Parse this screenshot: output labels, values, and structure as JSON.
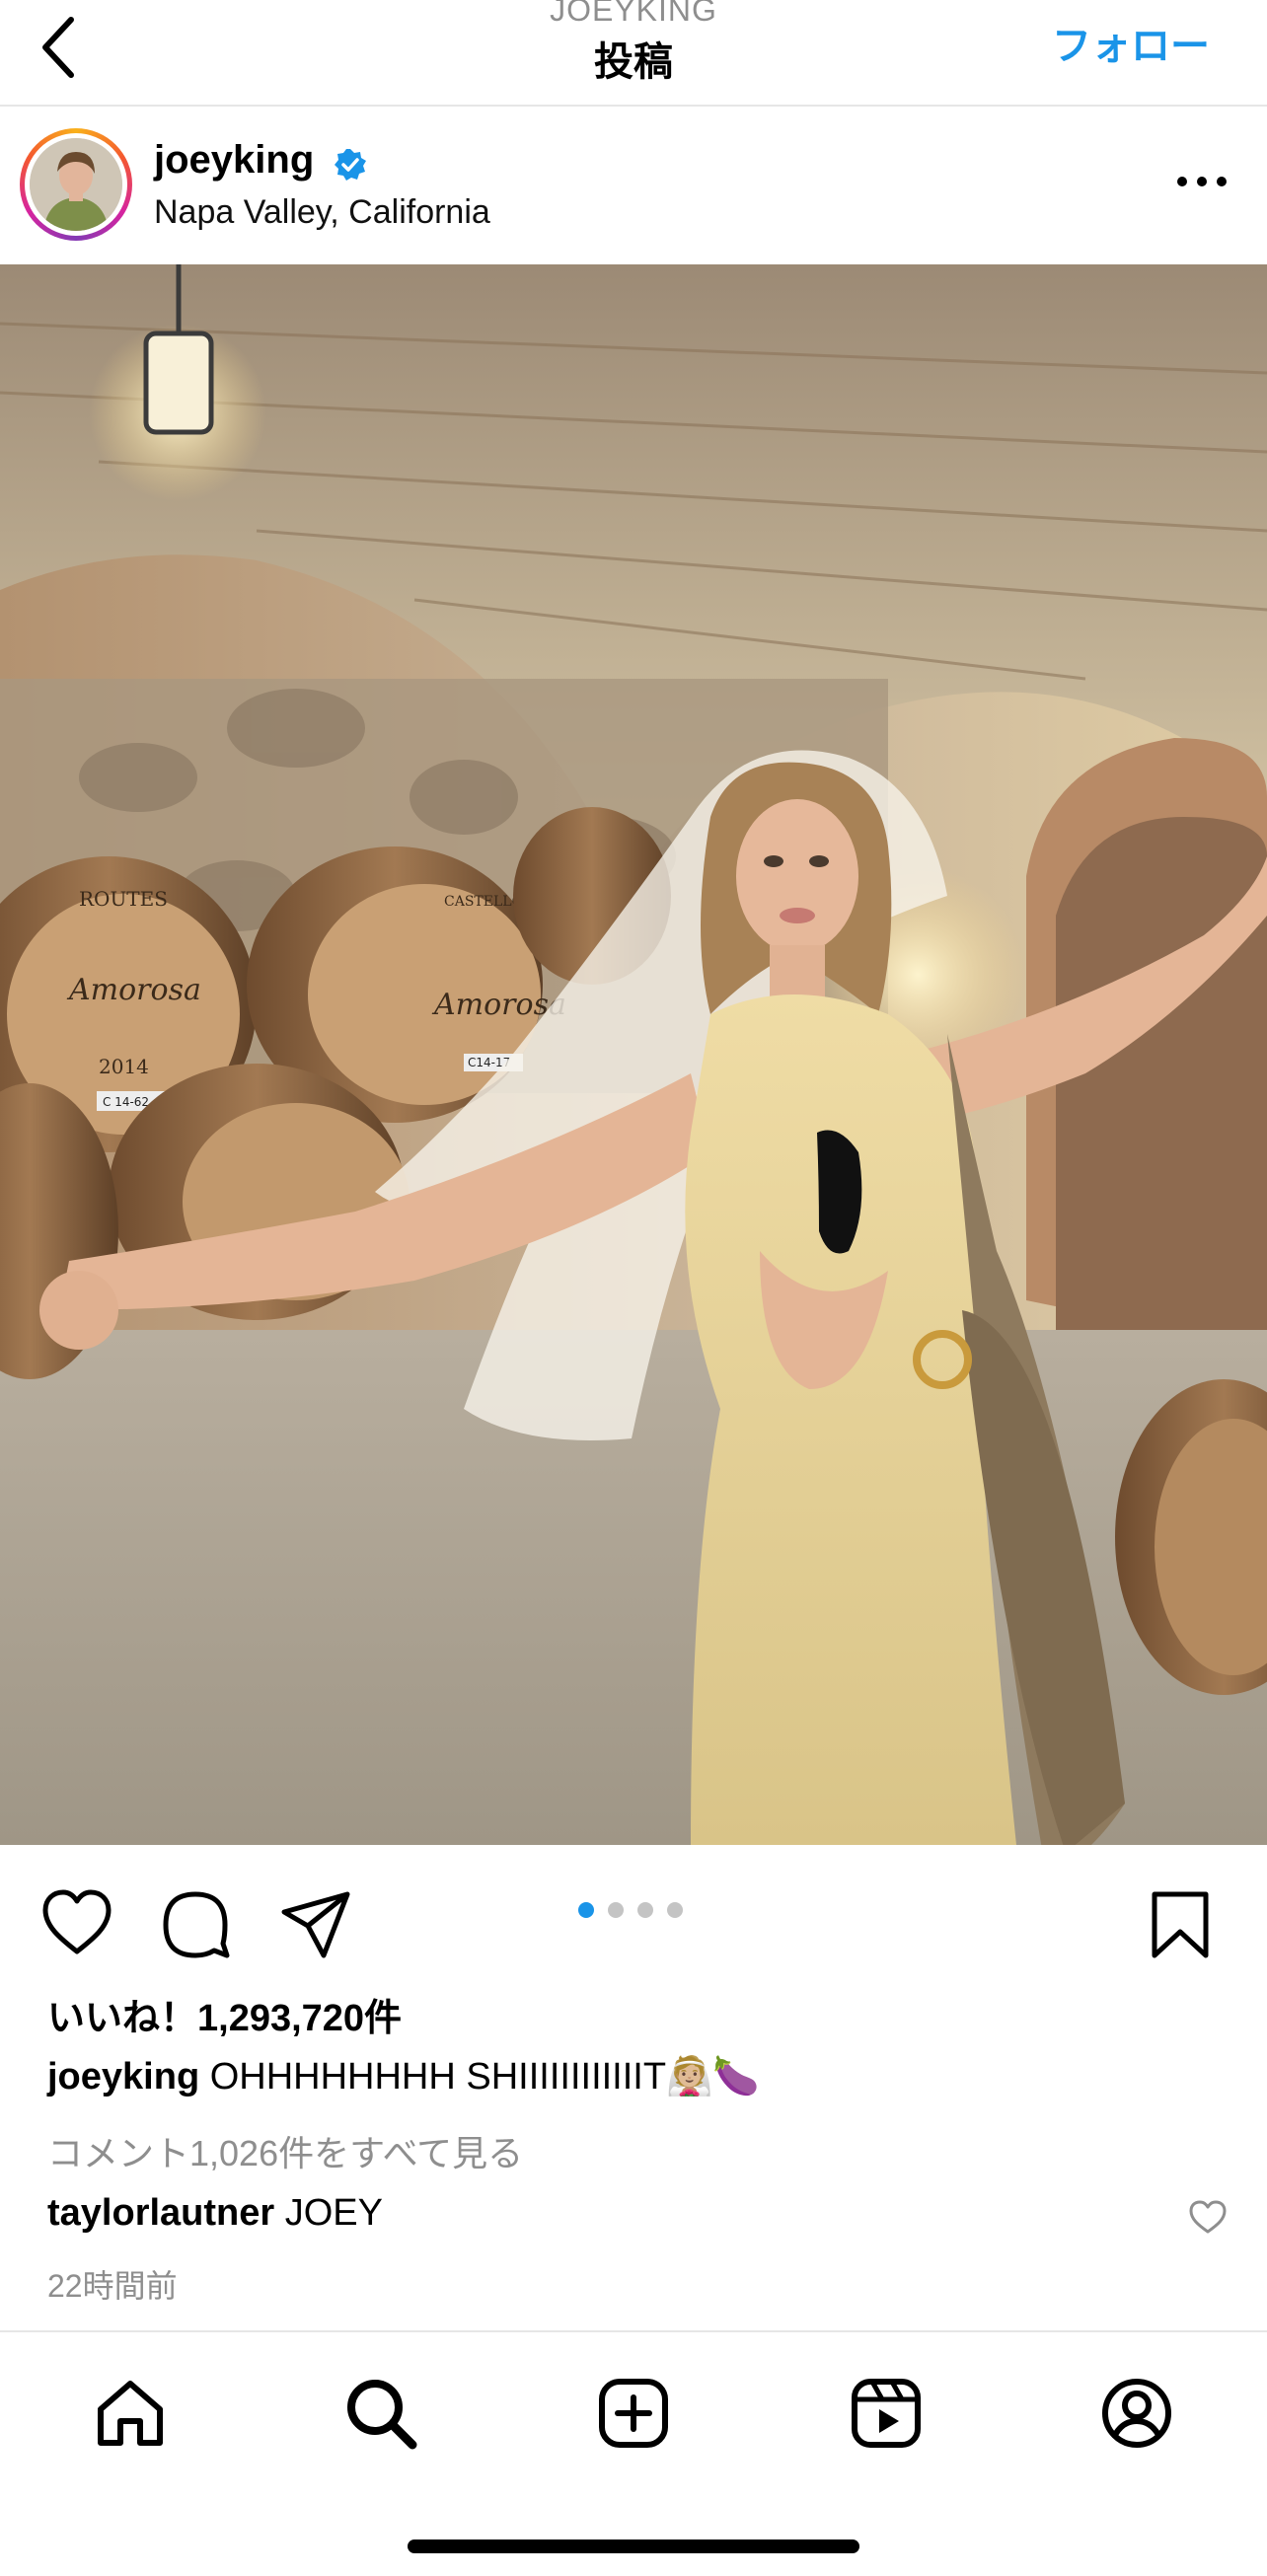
{
  "header": {
    "username": "JOEYKING",
    "title": "投稿",
    "follow_label": "フォロー"
  },
  "post": {
    "handle": "joeyking",
    "location": "Napa Valley, California",
    "likes": "いいね！1,293,720件",
    "caption_user": "joeyking",
    "caption_text": "OHHHHHHHH SHIIIIIIIIIIIIT👰🏼🍆",
    "view_comments": "コメント1,026件をすべて見る",
    "comment_user": "taylorlautner",
    "comment_text": "JOEY",
    "timestamp": "22時間前",
    "carousel": {
      "count": 4,
      "active": 1
    }
  },
  "barrels": {
    "b1_brand": "ROUTES",
    "b1_year": "2014",
    "b1_script": "Amorosa",
    "b1_code": "C 14-62",
    "b2_script": "Amorosa",
    "b2_code": "C14-17",
    "b2_brand": "CASTELLO"
  },
  "icons": {
    "back": "chevron-left-icon",
    "verified": "verified-badge-icon",
    "more": "more-icon",
    "like": "heart-icon",
    "comment": "comment-icon",
    "share": "send-icon",
    "save": "bookmark-icon",
    "home": "home-icon",
    "search": "search-icon",
    "create": "plus-square-icon",
    "reels": "reels-icon",
    "profile": "profile-icon"
  },
  "colors": {
    "accent": "#1a94e8",
    "muted": "#8e8e8e",
    "divider": "#e6e6e6"
  }
}
